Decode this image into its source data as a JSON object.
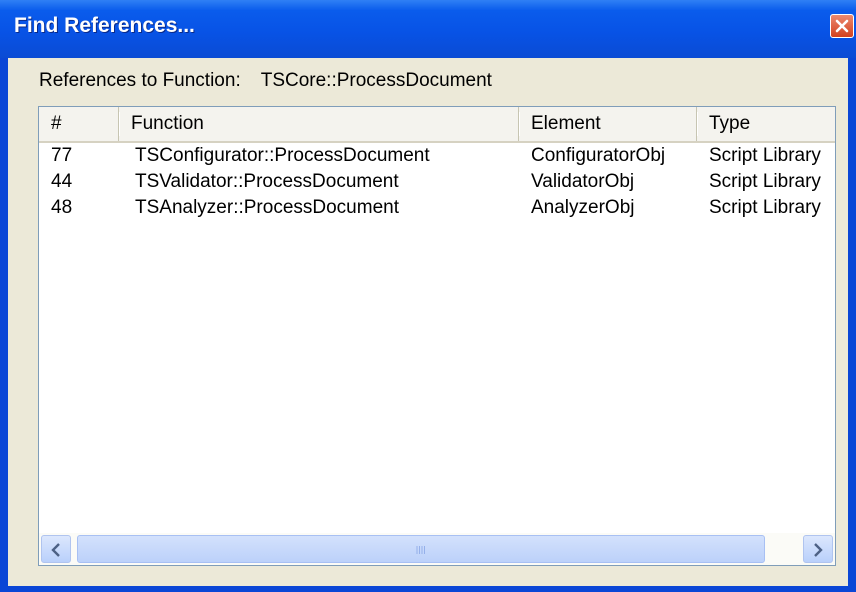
{
  "window": {
    "title": "Find References...",
    "close_icon": "close-icon"
  },
  "references": {
    "label": "References to Function:",
    "function_name": "TSCore::ProcessDocument"
  },
  "table": {
    "columns": [
      "#",
      "Function",
      "Element",
      "Type"
    ],
    "rows": [
      {
        "num": "77",
        "function": "TSConfigurator::ProcessDocument",
        "element": "ConfiguratorObj",
        "type": "Script Library"
      },
      {
        "num": "44",
        "function": "TSValidator::ProcessDocument",
        "element": "ValidatorObj",
        "type": "Script Library"
      },
      {
        "num": "48",
        "function": "TSAnalyzer::ProcessDocument",
        "element": "AnalyzerObj",
        "type": "Script Library"
      }
    ]
  },
  "scrollbar": {
    "left_icon": "chevron-left-icon",
    "right_icon": "chevron-right-icon",
    "grip_icon": "grip-icon"
  },
  "colors": {
    "titlebar": "#0a5cec",
    "client": "#ece9d8",
    "close_button": "#d3411e"
  }
}
